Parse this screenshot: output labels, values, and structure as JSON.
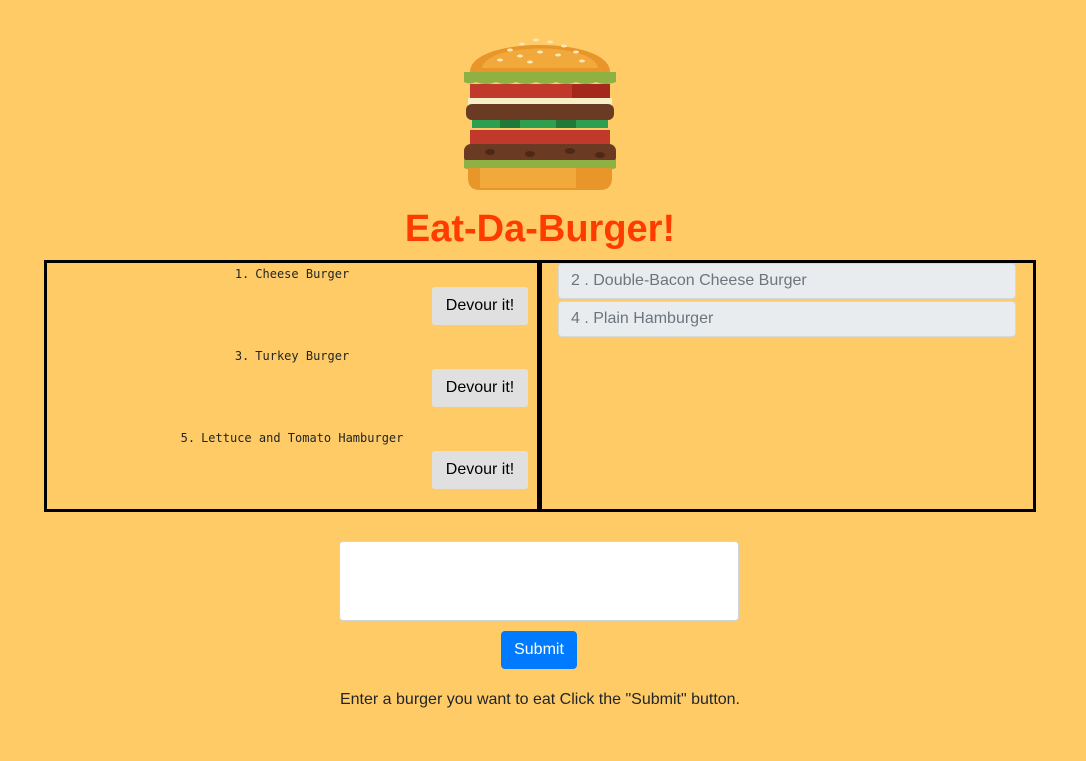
{
  "header": {
    "logo_icon": "burger-icon",
    "title": "Eat-Da-Burger!",
    "title_color": "#ff3c00"
  },
  "not_devoured": {
    "burgers": [
      {
        "number": "1.",
        "name": "Cheese Burger",
        "button_label": "Devour it!"
      },
      {
        "number": "3.",
        "name": "Turkey Burger",
        "button_label": "Devour it!"
      },
      {
        "number": "5.",
        "name": "Lettuce and Tomato Hamburger",
        "button_label": "Devour it!"
      }
    ]
  },
  "devoured": {
    "burgers": [
      {
        "label": "2 . Double-Bacon Cheese Burger"
      },
      {
        "label": "4 . Plain Hamburger"
      }
    ]
  },
  "form": {
    "input_value": "",
    "submit_label": "Submit",
    "instructions": "Enter a burger you want to eat Click the \"Submit\" button."
  },
  "colors": {
    "background": "#ffcb66",
    "submit": "#007bff"
  }
}
